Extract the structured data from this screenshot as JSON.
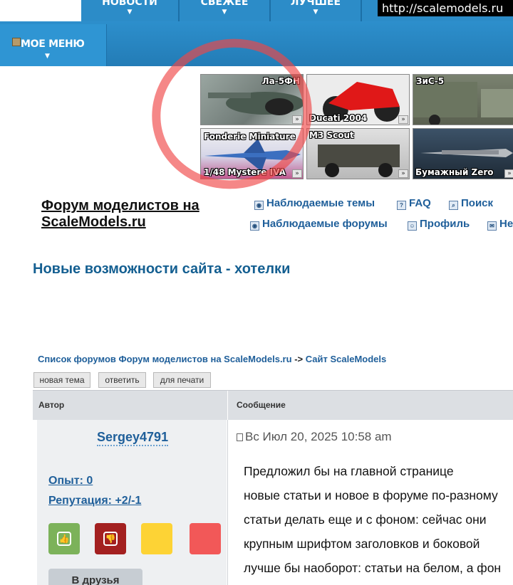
{
  "url_overlay": "http://scalemodels.ru",
  "top_nav": [
    {
      "label": "НОВОСТИ"
    },
    {
      "label": "СВЕЖЕЕ"
    },
    {
      "label": "ЛУЧШЕЕ"
    }
  ],
  "menu": {
    "label": "МОЕ МЕНЮ"
  },
  "banner_tiles": [
    {
      "caption": "Ла-5ФН",
      "bg": "#8a9691"
    },
    {
      "caption": "Ducati 2004",
      "bg": "#e8e8e8"
    },
    {
      "caption": "ЗиС-5",
      "bg": "#6e7567"
    },
    {
      "caption": "Fonderie Miniature",
      "caption2": "1/48 Mystere IVA",
      "bg": "#c86a9c"
    },
    {
      "caption": "M3 Scout",
      "bg": "#cfcfcf"
    },
    {
      "caption": "Бумажный Zero",
      "bg": "#34495c"
    }
  ],
  "site": {
    "title_line1": "Форум моделистов на",
    "title_line2": "ScaleModels.ru"
  },
  "quick_links": {
    "watched_topics": "Наблюдаемые темы",
    "faq": "FAQ",
    "search": "Поиск",
    "watched_forums": "Наблюдаемые форумы",
    "profile": "Профиль",
    "new_partial": "Не"
  },
  "topic": {
    "title": "Новые возможности сайта - хотелки"
  },
  "breadcrumbs": {
    "root": "Список форумов Форум моделистов на ScaleModels.ru",
    "separator": "->",
    "current": "Сайт ScaleModels"
  },
  "post_buttons": {
    "new_topic": "новая тема",
    "reply": "ответить",
    "print": "для печати"
  },
  "table_headers": {
    "author": "Автор",
    "message": "Сообщение"
  },
  "post": {
    "author": "Sergey4791",
    "experience": "Опыт: 0",
    "reputation": "Репутация: +2/-1",
    "friends_button": "В друзья",
    "date": "Вс Июл 20, 2025 10:58 am",
    "lines": [
      "Предложил бы на главной странице",
      "новые статьи и новое в форуме по-разному",
      "статьи делать еще и с фоном: сейчас они",
      "крупным шрифтом заголовков и боковой",
      "лучше бы наоборот: статьи на белом, а фон"
    ]
  },
  "reaction_colors": {
    "like": "#7cb25a",
    "dislike": "#a32020",
    "yellow": "#fdd335",
    "red": "#f25858"
  }
}
